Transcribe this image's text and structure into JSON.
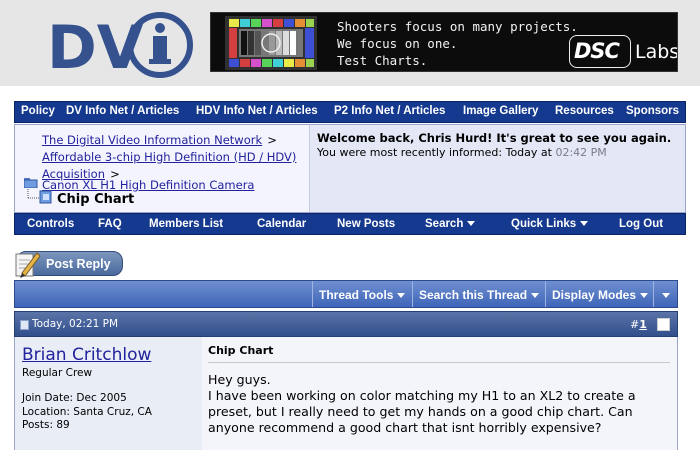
{
  "header": {
    "logo_text": "DVi",
    "banner": {
      "lines": [
        "Shooters focus on many projects.",
        "We focus on one.",
        "Test Charts."
      ],
      "brand": "DSC",
      "brand_suffix": "Labs"
    }
  },
  "top_nav": [
    "Policy",
    "DV Info Net / Articles",
    "HDV Info Net / Articles",
    "P2 Info Net / Articles",
    "Image Gallery",
    "Resources",
    "Sponsors"
  ],
  "breadcrumb": {
    "links": [
      "The Digital Video Information Network",
      "Affordable 3-chip High Definition (HD / HDV) Acquisition",
      "Canon XL H1 High Definition Camera"
    ],
    "separator": ">",
    "current": "Chip Chart"
  },
  "welcome": {
    "title": "Welcome back, Chris Hurd! It's great to see you again.",
    "line_prefix": "You were most recently informed: Today at",
    "time": "02:42 PM"
  },
  "sub_nav": [
    {
      "label": "Controls",
      "caret": false
    },
    {
      "label": "FAQ",
      "caret": false
    },
    {
      "label": "Members List",
      "caret": false
    },
    {
      "label": "Calendar",
      "caret": false
    },
    {
      "label": "New Posts",
      "caret": false
    },
    {
      "label": "Search",
      "caret": true
    },
    {
      "label": "Quick Links",
      "caret": true
    },
    {
      "label": "Log Out",
      "caret": false
    }
  ],
  "post_reply_label": "Post Reply",
  "thread_tools": [
    {
      "label": "Thread Tools"
    },
    {
      "label": "Search this Thread"
    },
    {
      "label": "Display Modes"
    }
  ],
  "post": {
    "date": "Today, 02:21 PM",
    "number_prefix": "#",
    "number": "1",
    "author": {
      "name": "Brian Critchlow",
      "rank": "Regular Crew",
      "join_date": "Join Date: Dec 2005",
      "location": "Location: Santa Cruz, CA",
      "posts": "Posts: 89"
    },
    "title": "Chip Chart",
    "greeting": "Hey guys.",
    "body": "I have been working on color matching my H1 to an XL2 to create a preset, but I really need to get my hands on a good chip chart. Can anyone recommend a good chart that isnt horribly expensive?"
  },
  "colors": {
    "nav_bg": "#14398e",
    "link": "#22229c",
    "thread_bar": "#3e65b8",
    "header_bg": "#e6e6e6"
  }
}
